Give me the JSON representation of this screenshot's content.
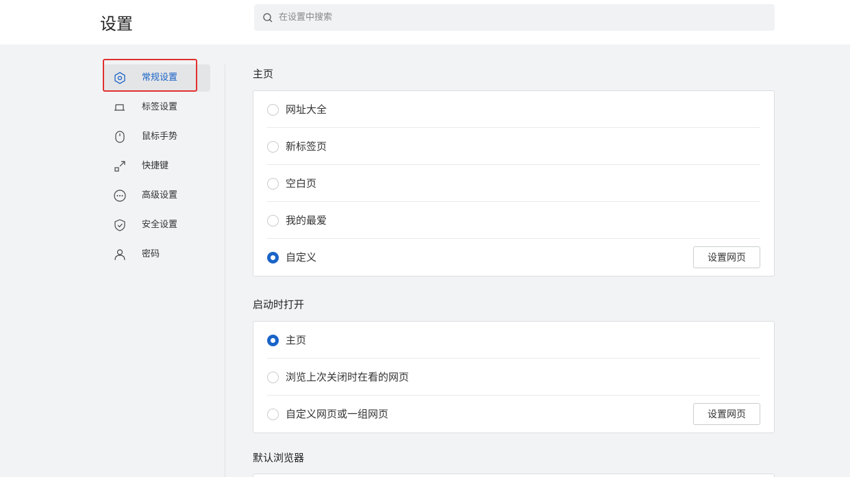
{
  "header": {
    "title": "设置",
    "search_placeholder": "在设置中搜索"
  },
  "sidebar": {
    "items": [
      {
        "label": "常规设置",
        "icon": "hexagon-gear-icon",
        "active": true
      },
      {
        "label": "标签设置",
        "icon": "tab-icon",
        "active": false
      },
      {
        "label": "鼠标手势",
        "icon": "mouse-icon",
        "active": false
      },
      {
        "label": "快捷键",
        "icon": "shortcut-arrow-icon",
        "active": false
      },
      {
        "label": "高级设置",
        "icon": "more-circle-icon",
        "active": false
      },
      {
        "label": "安全设置",
        "icon": "shield-icon",
        "active": false
      },
      {
        "label": "密码",
        "icon": "user-icon",
        "active": false
      }
    ]
  },
  "homepage": {
    "title": "主页",
    "options": [
      "网址大全",
      "新标签页",
      "空白页",
      "我的最爱",
      "自定义"
    ],
    "selected": "自定义",
    "button_label": "设置网页"
  },
  "startup": {
    "title": "启动时打开",
    "options": [
      "主页",
      "浏览上次关闭时在看的网页",
      "自定义网页或一组网页"
    ],
    "selected": "主页",
    "button_label": "设置网页"
  },
  "default_browser": {
    "title": "默认浏览器"
  },
  "colors": {
    "accent": "#1a64c8",
    "highlight": "#e0302f"
  }
}
